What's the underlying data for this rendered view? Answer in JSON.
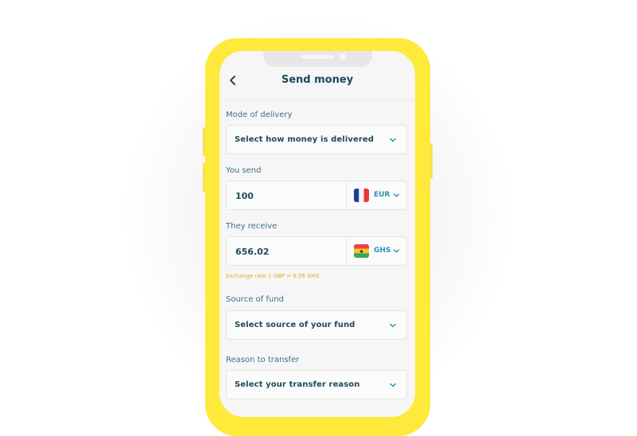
{
  "header": {
    "title": "Send money",
    "back_icon": "chevron-left-icon"
  },
  "delivery": {
    "label": "Mode of delivery",
    "placeholder": "Select how money is delivered"
  },
  "send": {
    "label": "You send",
    "amount": "100",
    "currency": "EUR",
    "flag": "france-flag-icon"
  },
  "receive": {
    "label": "They receive",
    "amount": "656.02",
    "currency": "GHS",
    "flag": "ghana-flag-icon"
  },
  "exchange_rate": "Exchange rate 1 GBP = 6.56 GHS",
  "source": {
    "label": "Source of fund",
    "placeholder": "Select source of your fund"
  },
  "reason": {
    "label": "Reason to transfer",
    "placeholder": "Select your transfer reason"
  },
  "colors": {
    "frame": "#ffe93a",
    "text_dark": "#1d4a5c",
    "accent": "#2c8fb7",
    "rate": "#f0a032"
  }
}
